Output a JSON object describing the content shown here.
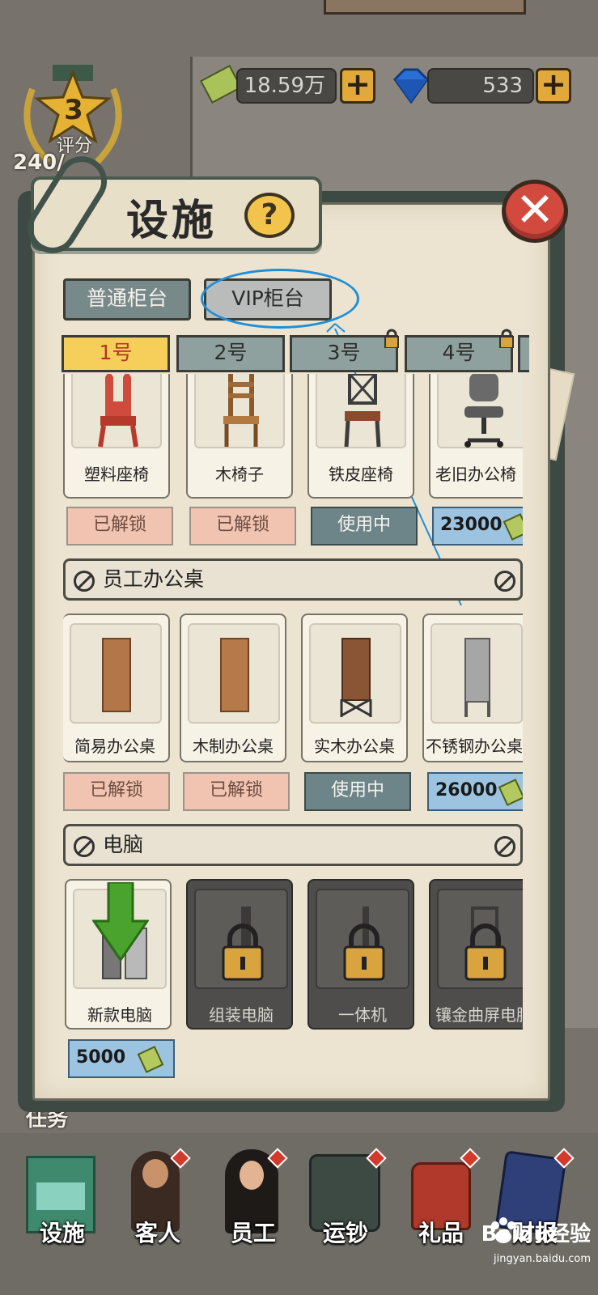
{
  "currency": {
    "money": "18.59万",
    "gems": "533"
  },
  "rating": {
    "level": "3",
    "label": "评分",
    "progress": "240/"
  },
  "dialog": {
    "title": "设施",
    "help": "?",
    "close": "✕"
  },
  "counter_tabs": [
    {
      "label": "普通柜台",
      "active": true
    },
    {
      "label": "VIP柜台",
      "active": false,
      "highlighted": true
    }
  ],
  "number_tabs": [
    {
      "label": "1号",
      "active": true,
      "locked": false
    },
    {
      "label": "2号",
      "active": false,
      "locked": false
    },
    {
      "label": "3号",
      "active": false,
      "locked": true
    },
    {
      "label": "4号",
      "active": false,
      "locked": true
    }
  ],
  "chairs": [
    {
      "name": "塑料座椅",
      "status": "已解锁",
      "kind": "unlocked"
    },
    {
      "name": "木椅子",
      "status": "已解锁",
      "kind": "unlocked"
    },
    {
      "name": "铁皮座椅",
      "status": "使用中",
      "kind": "inuse"
    },
    {
      "name": "老旧办公椅",
      "status": "23000",
      "kind": "price"
    }
  ],
  "desk_section": {
    "title": "员工办公桌"
  },
  "desks": [
    {
      "name": "简易办公桌",
      "status": "已解锁",
      "kind": "unlocked",
      "color": "#b27649"
    },
    {
      "name": "木制办公桌",
      "status": "已解锁",
      "kind": "unlocked",
      "color": "#b5794a"
    },
    {
      "name": "实木办公桌",
      "status": "使用中",
      "kind": "inuse",
      "color": "#8a5535"
    },
    {
      "name": "不锈钢办公桌",
      "status": "26000",
      "kind": "price",
      "color": "#a6a6a6"
    }
  ],
  "pc_section": {
    "title": "电脑"
  },
  "computers": [
    {
      "name": "新款电脑",
      "locked": false,
      "price": "5000"
    },
    {
      "name": "组装电脑",
      "locked": true
    },
    {
      "name": "一体机",
      "locked": true
    },
    {
      "name": "镶金曲屏电脑",
      "locked": true
    }
  ],
  "bottom_nav": [
    {
      "label": "设施"
    },
    {
      "label": "客人"
    },
    {
      "label": "员工"
    },
    {
      "label": "运钞"
    },
    {
      "label": "礼品"
    },
    {
      "label": "财报"
    }
  ],
  "background": {
    "task_label": "任务"
  },
  "watermark": {
    "brand": "Baidu经验",
    "url": "jingyan.baidu.com"
  }
}
